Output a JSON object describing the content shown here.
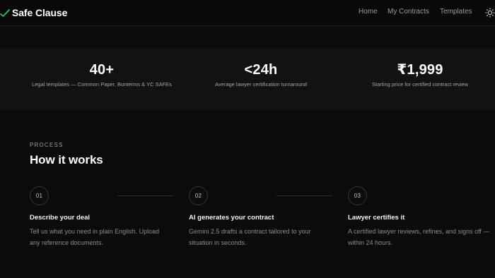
{
  "header": {
    "brand": "Safe Clause",
    "nav": [
      "Home",
      "My Contracts",
      "Templates"
    ]
  },
  "stats": [
    {
      "value": "40+",
      "label": "Legal templates — Common Paper, Bonterms & YC SAFEs"
    },
    {
      "value": "<24h",
      "label": "Average lawyer certification turnaround"
    },
    {
      "value": "₹1,999",
      "label": "Starting price for certified contract review"
    }
  ],
  "process": {
    "eyebrow": "PROCESS",
    "title": "How it works",
    "steps": [
      {
        "number": "01",
        "title": "Describe your deal",
        "description": "Tell us what you need in plain English. Upload any reference documents."
      },
      {
        "number": "02",
        "title": "AI generates your contract",
        "description": "Gemini 2.5 drafts a contract tailored to your situation in seconds."
      },
      {
        "number": "03",
        "title": "Lawyer certifies it",
        "description": "A certified lawyer reviews, refines, and signs off — within 24 hours."
      }
    ]
  },
  "colors": {
    "background": "#0b0b0d",
    "stats_band": "#121215",
    "brand_accent": "#22c55e",
    "text_primary": "#ffffff",
    "text_muted": "#8b8b93"
  },
  "icons": {
    "brand": "check-icon",
    "theme_toggle": "sun-icon"
  }
}
